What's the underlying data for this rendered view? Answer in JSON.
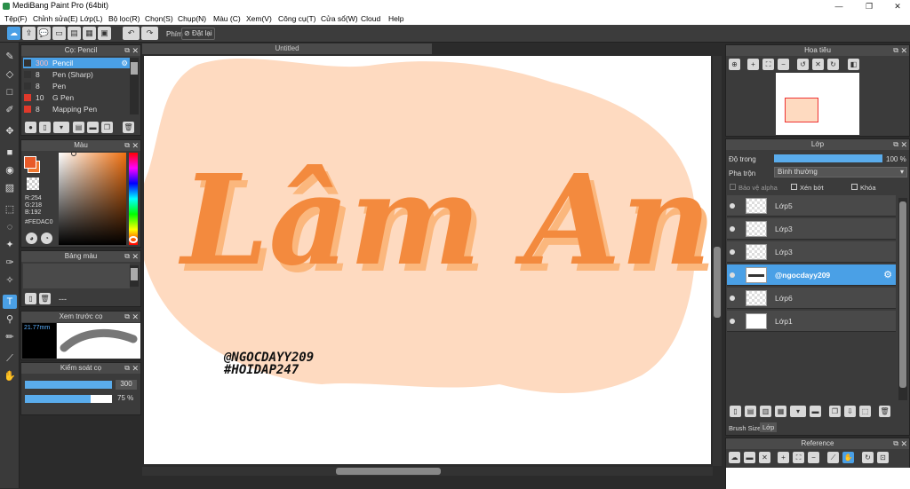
{
  "window": {
    "title": "MediBang Paint Pro (64bit)",
    "minimize": "—",
    "restore": "❐",
    "close": "✕"
  },
  "menu": [
    "Tệp(F)",
    "Chỉnh sửa(E)",
    "Lớp(L)",
    "Bộ lọc(R)",
    "Chọn(S)",
    "Chụp(N)",
    "Màu (C)",
    "Xem(V)",
    "Công cụ(T)",
    "Cửa sổ(W)",
    "Cloud",
    "Help"
  ],
  "toolbar": {
    "shortcut_label": "Phím",
    "reset_label": "Đặt lại"
  },
  "brush_panel": {
    "title": "Cọ: Pencil",
    "items": [
      {
        "size": "300",
        "name": "Pencil",
        "color": "#333333"
      },
      {
        "size": "8",
        "name": "Pen (Sharp)",
        "color": "#333333"
      },
      {
        "size": "8",
        "name": "Pen",
        "color": "#333333"
      },
      {
        "size": "10",
        "name": "G Pen",
        "color": "#e0392b"
      },
      {
        "size": "8",
        "name": "Mapping Pen",
        "color": "#e0392b"
      }
    ]
  },
  "color_panel": {
    "title": "Màu",
    "r": "R:254",
    "g": "G:218",
    "b": "B:192",
    "hex": "#FEDAC0",
    "fg": "#f07830",
    "bg": "#fedac0"
  },
  "palette_panel": {
    "title": "Bảng màu",
    "extra": "---"
  },
  "preview_panel": {
    "title": "Xem trước cọ",
    "size": "21.77mm"
  },
  "control_panel": {
    "title": "Kiểm soát cọ",
    "size_value": "300",
    "opacity_value": "75 %",
    "size_fraction": 1.0,
    "opacity_fraction": 0.75
  },
  "document": {
    "tab": "Untitled",
    "lettering": "Lâm Anh",
    "watermark_line1": "@NGOCDAYY209",
    "watermark_line2": "#HOIDAP247",
    "blob_color": "#fedac0",
    "letter_color": "#f38a3e",
    "shadow_color": "#fbb77d"
  },
  "navigator": {
    "title": "Hoa tiêu"
  },
  "layer_panel": {
    "title": "Lớp",
    "opacity_label": "Độ trong",
    "opacity_value": "100 %",
    "opacity_fraction": 1.0,
    "blend_label": "Pha trộn",
    "blend_value": "Bình thường",
    "protect_alpha": "Bảo vệ alpha",
    "clipping": "Xén bớt",
    "lock": "Khóa",
    "layers": [
      {
        "name": "Lớp5",
        "selected": false
      },
      {
        "name": "Lớp3",
        "selected": false
      },
      {
        "name": "Lớp3",
        "selected": false
      },
      {
        "name": "@ngocdayy209",
        "selected": true
      },
      {
        "name": "Lớp6",
        "selected": false
      },
      {
        "name": "Lớp1",
        "selected": false
      }
    ]
  },
  "bottom_tabs": {
    "brush_size": "Brush Size",
    "layer": "Lớp"
  },
  "reference_panel": {
    "title": "Reference"
  }
}
